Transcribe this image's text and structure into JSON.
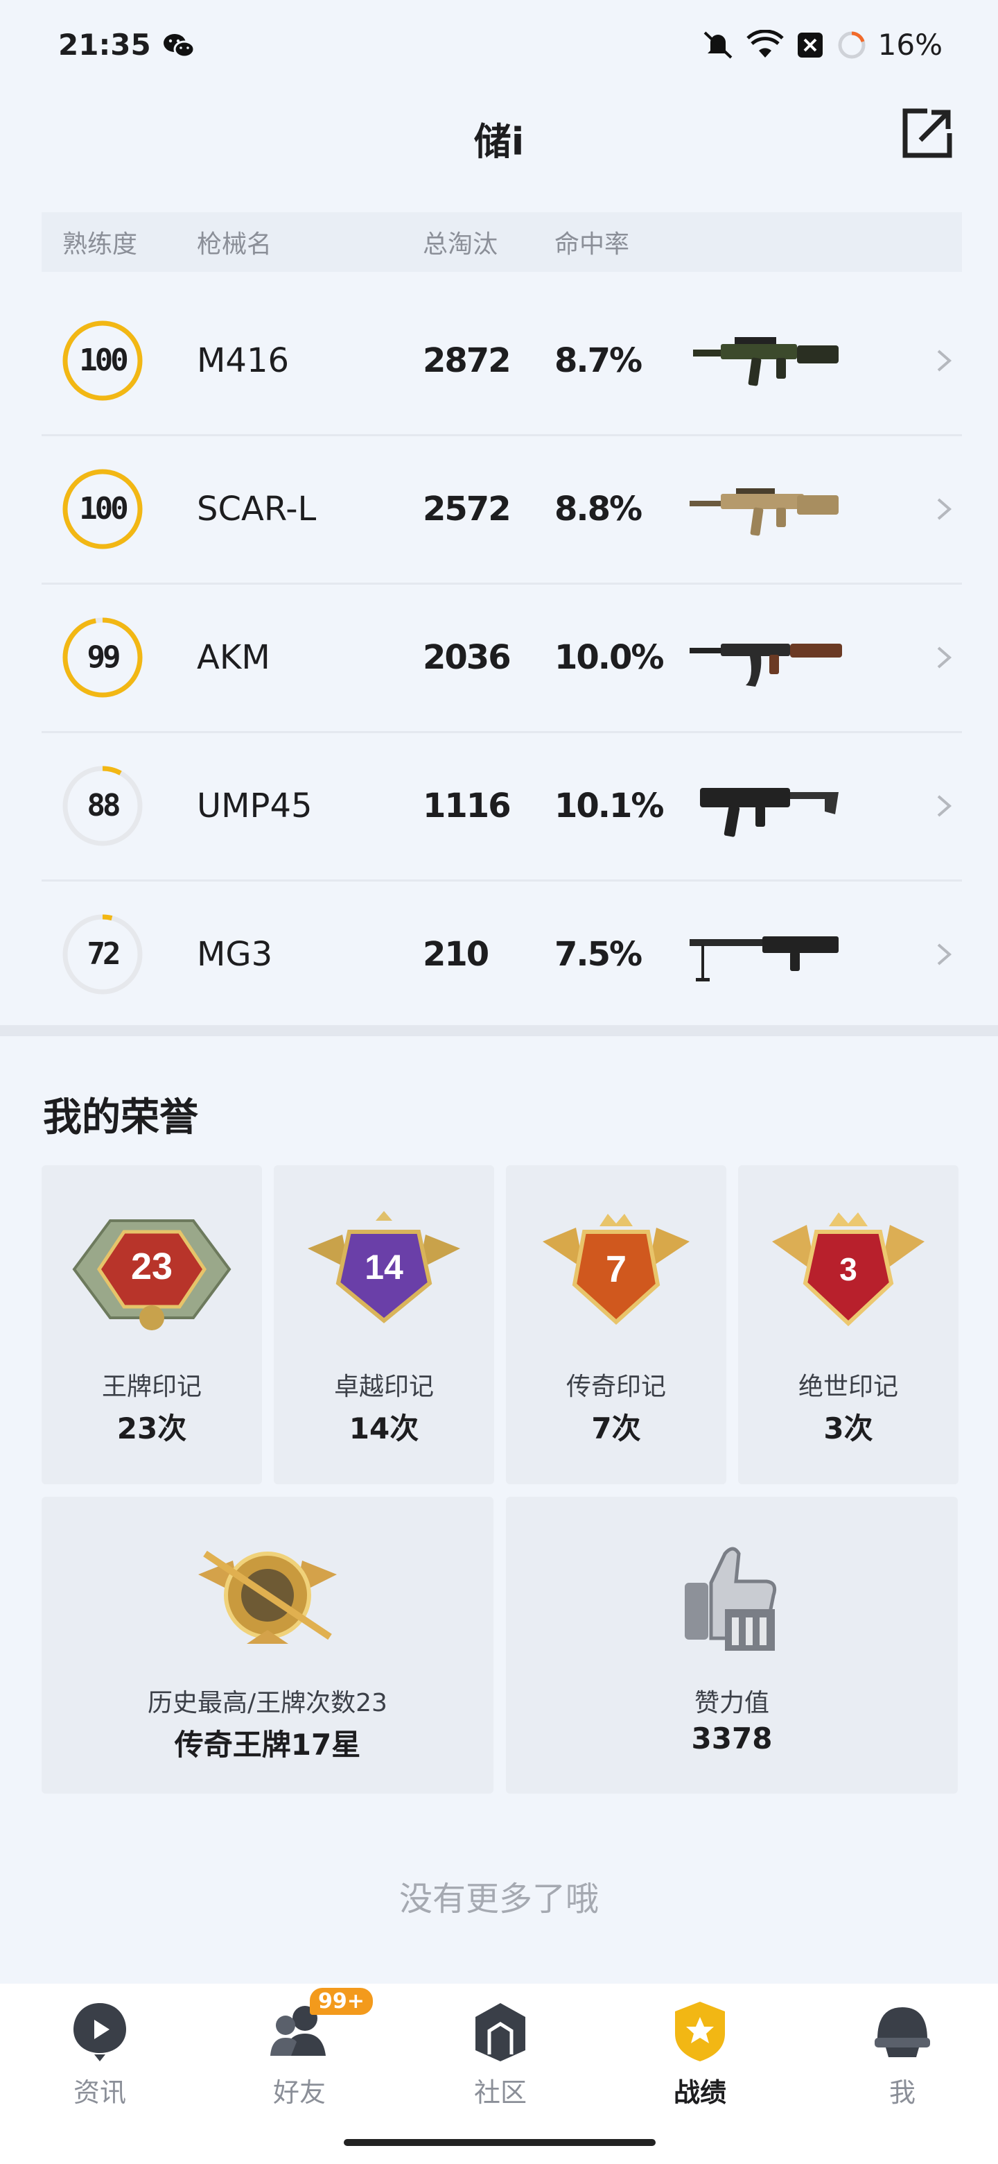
{
  "status_bar": {
    "time": "21:35",
    "battery": "16%"
  },
  "header": {
    "title": "储i"
  },
  "weapons": {
    "columns": [
      "熟练度",
      "枪械名",
      "总淘汰",
      "命中率"
    ],
    "rows": [
      {
        "mastery": "100",
        "progress": 1.0,
        "name": "M416",
        "kills": "2872",
        "accuracy": "8.7%"
      },
      {
        "mastery": "100",
        "progress": 1.0,
        "name": "SCAR-L",
        "kills": "2572",
        "accuracy": "8.8%"
      },
      {
        "mastery": "99",
        "progress": 0.97,
        "name": "AKM",
        "kills": "2036",
        "accuracy": "10.0%"
      },
      {
        "mastery": "88",
        "progress": 0.08,
        "name": "UMP45",
        "kills": "1116",
        "accuracy": "10.1%"
      },
      {
        "mastery": "72",
        "progress": 0.04,
        "name": "MG3",
        "kills": "210",
        "accuracy": "7.5%"
      }
    ]
  },
  "honors": {
    "title": "我的荣誉",
    "marks": [
      {
        "badge_num": "23",
        "label": "王牌印记",
        "value": "23次"
      },
      {
        "badge_num": "14",
        "label": "卓越印记",
        "value": "14次"
      },
      {
        "badge_num": "7",
        "label": "传奇印记",
        "value": "7次"
      },
      {
        "badge_num": "3",
        "label": "绝世印记",
        "value": "3次"
      }
    ],
    "highest": {
      "label": "历史最高/王牌次数23",
      "value": "传奇王牌17星"
    },
    "likes": {
      "label": "赞力值",
      "value": "3378"
    }
  },
  "footer_note": "没有更多了哦",
  "nav": {
    "items": [
      {
        "label": "资讯"
      },
      {
        "label": "好友"
      },
      {
        "label": "社区"
      },
      {
        "label": "战绩"
      },
      {
        "label": "我"
      }
    ],
    "friends_badge": "99+",
    "active": "战绩"
  },
  "colors": {
    "accent": "#f2b714",
    "ring_track": "#e6e8ec",
    "badge": "#f39a1c"
  }
}
